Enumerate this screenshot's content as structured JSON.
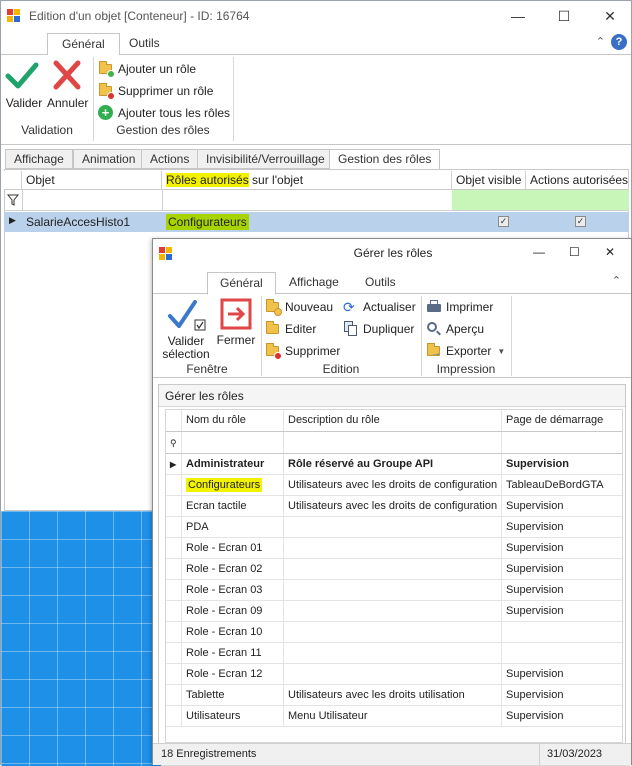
{
  "main_window": {
    "title": "Edition d'un objet [Conteneur] - ID: 16764",
    "ribbon_tabs": [
      "Général",
      "Outils"
    ],
    "help_icon": "question-icon",
    "groups": {
      "validation": {
        "label": "Validation",
        "valider": "Valider",
        "annuler": "Annuler"
      },
      "gestion": {
        "label": "Gestion des rôles",
        "ajouter": "Ajouter un rôle",
        "supprimer": "Supprimer un rôle",
        "ajouter_tous": "Ajouter tous les rôles"
      }
    },
    "page_tabs": [
      "Affichage",
      "Animation",
      "Actions",
      "Invisibilité/Verrouillage",
      "Gestion des rôles"
    ],
    "grid": {
      "columns": {
        "objet": "Objet",
        "roles_hl": "Rôles autorisés",
        "roles_rest": " sur l'objet",
        "visible": "Objet visible",
        "actions": "Actions autorisées"
      },
      "rows": [
        {
          "objet": "SalarieAccesHisto1",
          "roles": "Configurateurs",
          "visible": true,
          "actions": true
        }
      ]
    }
  },
  "roles_window": {
    "title": "Gérer les rôles",
    "ribbon_tabs": [
      "Général",
      "Affichage",
      "Outils"
    ],
    "fenetre": {
      "label": "Fenêtre",
      "valider_line1": "Valider",
      "valider_line2": "sélection",
      "fermer": "Fermer"
    },
    "edition": {
      "label": "Edition",
      "nouveau": "Nouveau",
      "editer": "Editer",
      "supprimer": "Supprimer",
      "actualiser": "Actualiser",
      "dupliquer": "Dupliquer"
    },
    "impression": {
      "label": "Impression",
      "imprimer": "Imprimer",
      "apercu": "Aperçu",
      "exporter": "Exporter"
    },
    "panel_title": "Gérer les rôles",
    "columns": [
      "Nom du rôle",
      "Description du rôle",
      "Page de démarrage"
    ],
    "rows": [
      {
        "nom": "Administrateur",
        "desc": "Rôle réservé au Groupe API",
        "page": "Supervision",
        "bold": true,
        "current": true
      },
      {
        "nom": "Configurateurs",
        "desc": "Utilisateurs avec les droits de configuration",
        "page": "TableauDeBordGTA",
        "highlight": true
      },
      {
        "nom": "Ecran tactile",
        "desc": "Utilisateurs avec les droits de configuration",
        "page": "Supervision"
      },
      {
        "nom": "PDA",
        "desc": "",
        "page": "Supervision"
      },
      {
        "nom": "Role - Ecran 01",
        "desc": "",
        "page": "Supervision"
      },
      {
        "nom": "Role - Ecran 02",
        "desc": "",
        "page": "Supervision"
      },
      {
        "nom": "Role - Ecran 03",
        "desc": "",
        "page": "Supervision"
      },
      {
        "nom": "Role - Ecran 09",
        "desc": "",
        "page": "Supervision"
      },
      {
        "nom": "Role - Ecran 10",
        "desc": "",
        "page": ""
      },
      {
        "nom": "Role - Ecran 11",
        "desc": "",
        "page": ""
      },
      {
        "nom": "Role - Ecran 12",
        "desc": "",
        "page": "Supervision"
      },
      {
        "nom": "Tablette",
        "desc": "Utilisateurs avec les droits utilisation",
        "page": "Supervision"
      },
      {
        "nom": "Utilisateurs",
        "desc": "Menu Utilisateur",
        "page": "Supervision"
      }
    ],
    "status": {
      "count": "18 Enregistrements",
      "date": "31/03/2023"
    }
  },
  "colors": {
    "highlight_yellow": "#f2f200",
    "selection_blue": "#b9d1ea",
    "filter_green": "#c8f5b8",
    "canvas_blue": "#1e90e8"
  }
}
